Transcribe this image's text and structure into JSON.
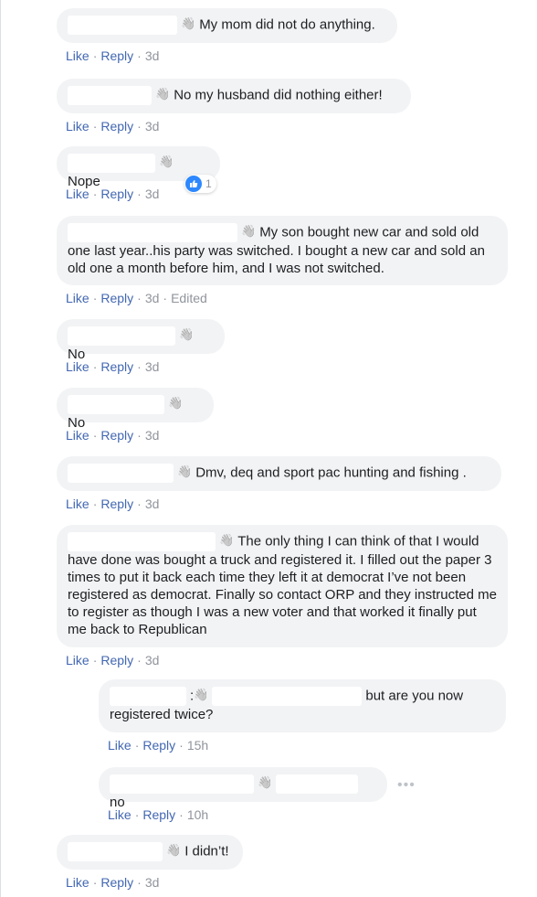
{
  "actions": {
    "like": "Like",
    "reply": "Reply",
    "sep": "·"
  },
  "comments": [
    {
      "text": "My mom did not do anything.",
      "time": "3d"
    },
    {
      "text": "No my husband did nothing either!",
      "time": "3d"
    },
    {
      "text": "Nope",
      "time": "3d",
      "reaction_count": "1"
    },
    {
      "text": "My son bought new car and sold old one last year..his party was switched. I bought a new car and sold an old one a month before him, and I was not switched.",
      "time": "3d",
      "edited": "Edited"
    },
    {
      "text": "No",
      "time": "3d"
    },
    {
      "text": "No",
      "time": "3d"
    },
    {
      "text": "Dmv, deq and sport pac hunting and fishing .",
      "time": "3d"
    },
    {
      "text": "The only thing I can think of that I would have done was bought a truck and registered it. I filled out the paper 3 times to put it back each time they left it at democrat I’ve not been registered as democrat. Finally so contact ORP and they instructed me to register as though I was a new voter and that worked it finally put me back to Republican",
      "time": "3d"
    },
    {
      "text": "but are you now registered twice?",
      "time": "15h",
      "colon": ":"
    },
    {
      "text": "no",
      "time": "10h"
    },
    {
      "text": "I didn’t!",
      "time": "3d"
    }
  ],
  "icons": {
    "wave": "waving-hand-icon",
    "thumb": "thumbs-up-icon",
    "more": "more-options-icon"
  }
}
